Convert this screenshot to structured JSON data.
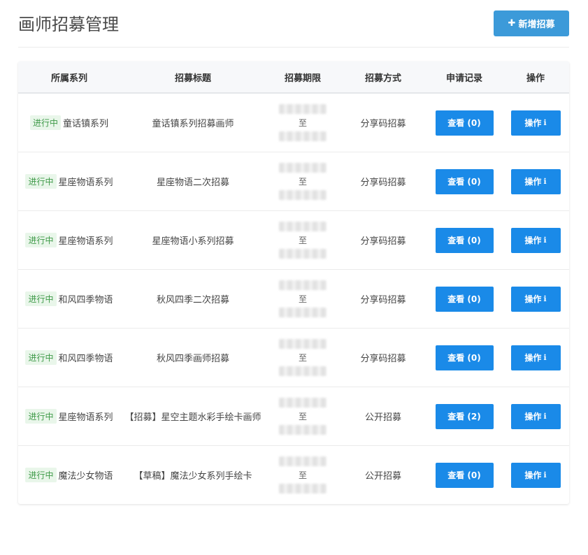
{
  "header": {
    "title": "画师招募管理",
    "add_button_label": "新增招募",
    "add_icon": "plus-icon"
  },
  "table": {
    "columns": [
      "所属系列",
      "招募标题",
      "招募期限",
      "招募方式",
      "申请记录",
      "操作"
    ],
    "rows": [
      {
        "status": "进行中",
        "series": "童话镇系列",
        "title": "童话镇系列招募画师",
        "period_separator": "至",
        "method": "分享码招募",
        "records_label": "查看 (0)",
        "action_label": "操作"
      },
      {
        "status": "进行中",
        "series": "星座物语系列",
        "title": "星座物语二次招募",
        "period_separator": "至",
        "method": "分享码招募",
        "records_label": "查看 (0)",
        "action_label": "操作"
      },
      {
        "status": "进行中",
        "series": "星座物语系列",
        "title": "星座物语小系列招募",
        "period_separator": "至",
        "method": "分享码招募",
        "records_label": "查看 (0)",
        "action_label": "操作"
      },
      {
        "status": "进行中",
        "series": "和风四季物语",
        "title": "秋风四季二次招募",
        "period_separator": "至",
        "method": "分享码招募",
        "records_label": "查看 (0)",
        "action_label": "操作"
      },
      {
        "status": "进行中",
        "series": "和风四季物语",
        "title": "秋风四季画师招募",
        "period_separator": "至",
        "method": "分享码招募",
        "records_label": "查看 (0)",
        "action_label": "操作"
      },
      {
        "status": "进行中",
        "series": "星座物语系列",
        "title": "【招募】星空主题水彩手绘卡画师",
        "period_separator": "至",
        "method": "公开招募",
        "records_label": "查看 (2)",
        "action_label": "操作"
      },
      {
        "status": "进行中",
        "series": "魔法少女物语",
        "title": "【草稿】魔法少女系列手绘卡",
        "period_separator": "至",
        "method": "公开招募",
        "records_label": "查看 (0)",
        "action_label": "操作"
      }
    ]
  },
  "colors": {
    "primary_button": "#1a8ae8",
    "add_button": "#3c9ad9",
    "status_bg": "#e9f6ea",
    "status_text": "#3e9a48"
  }
}
